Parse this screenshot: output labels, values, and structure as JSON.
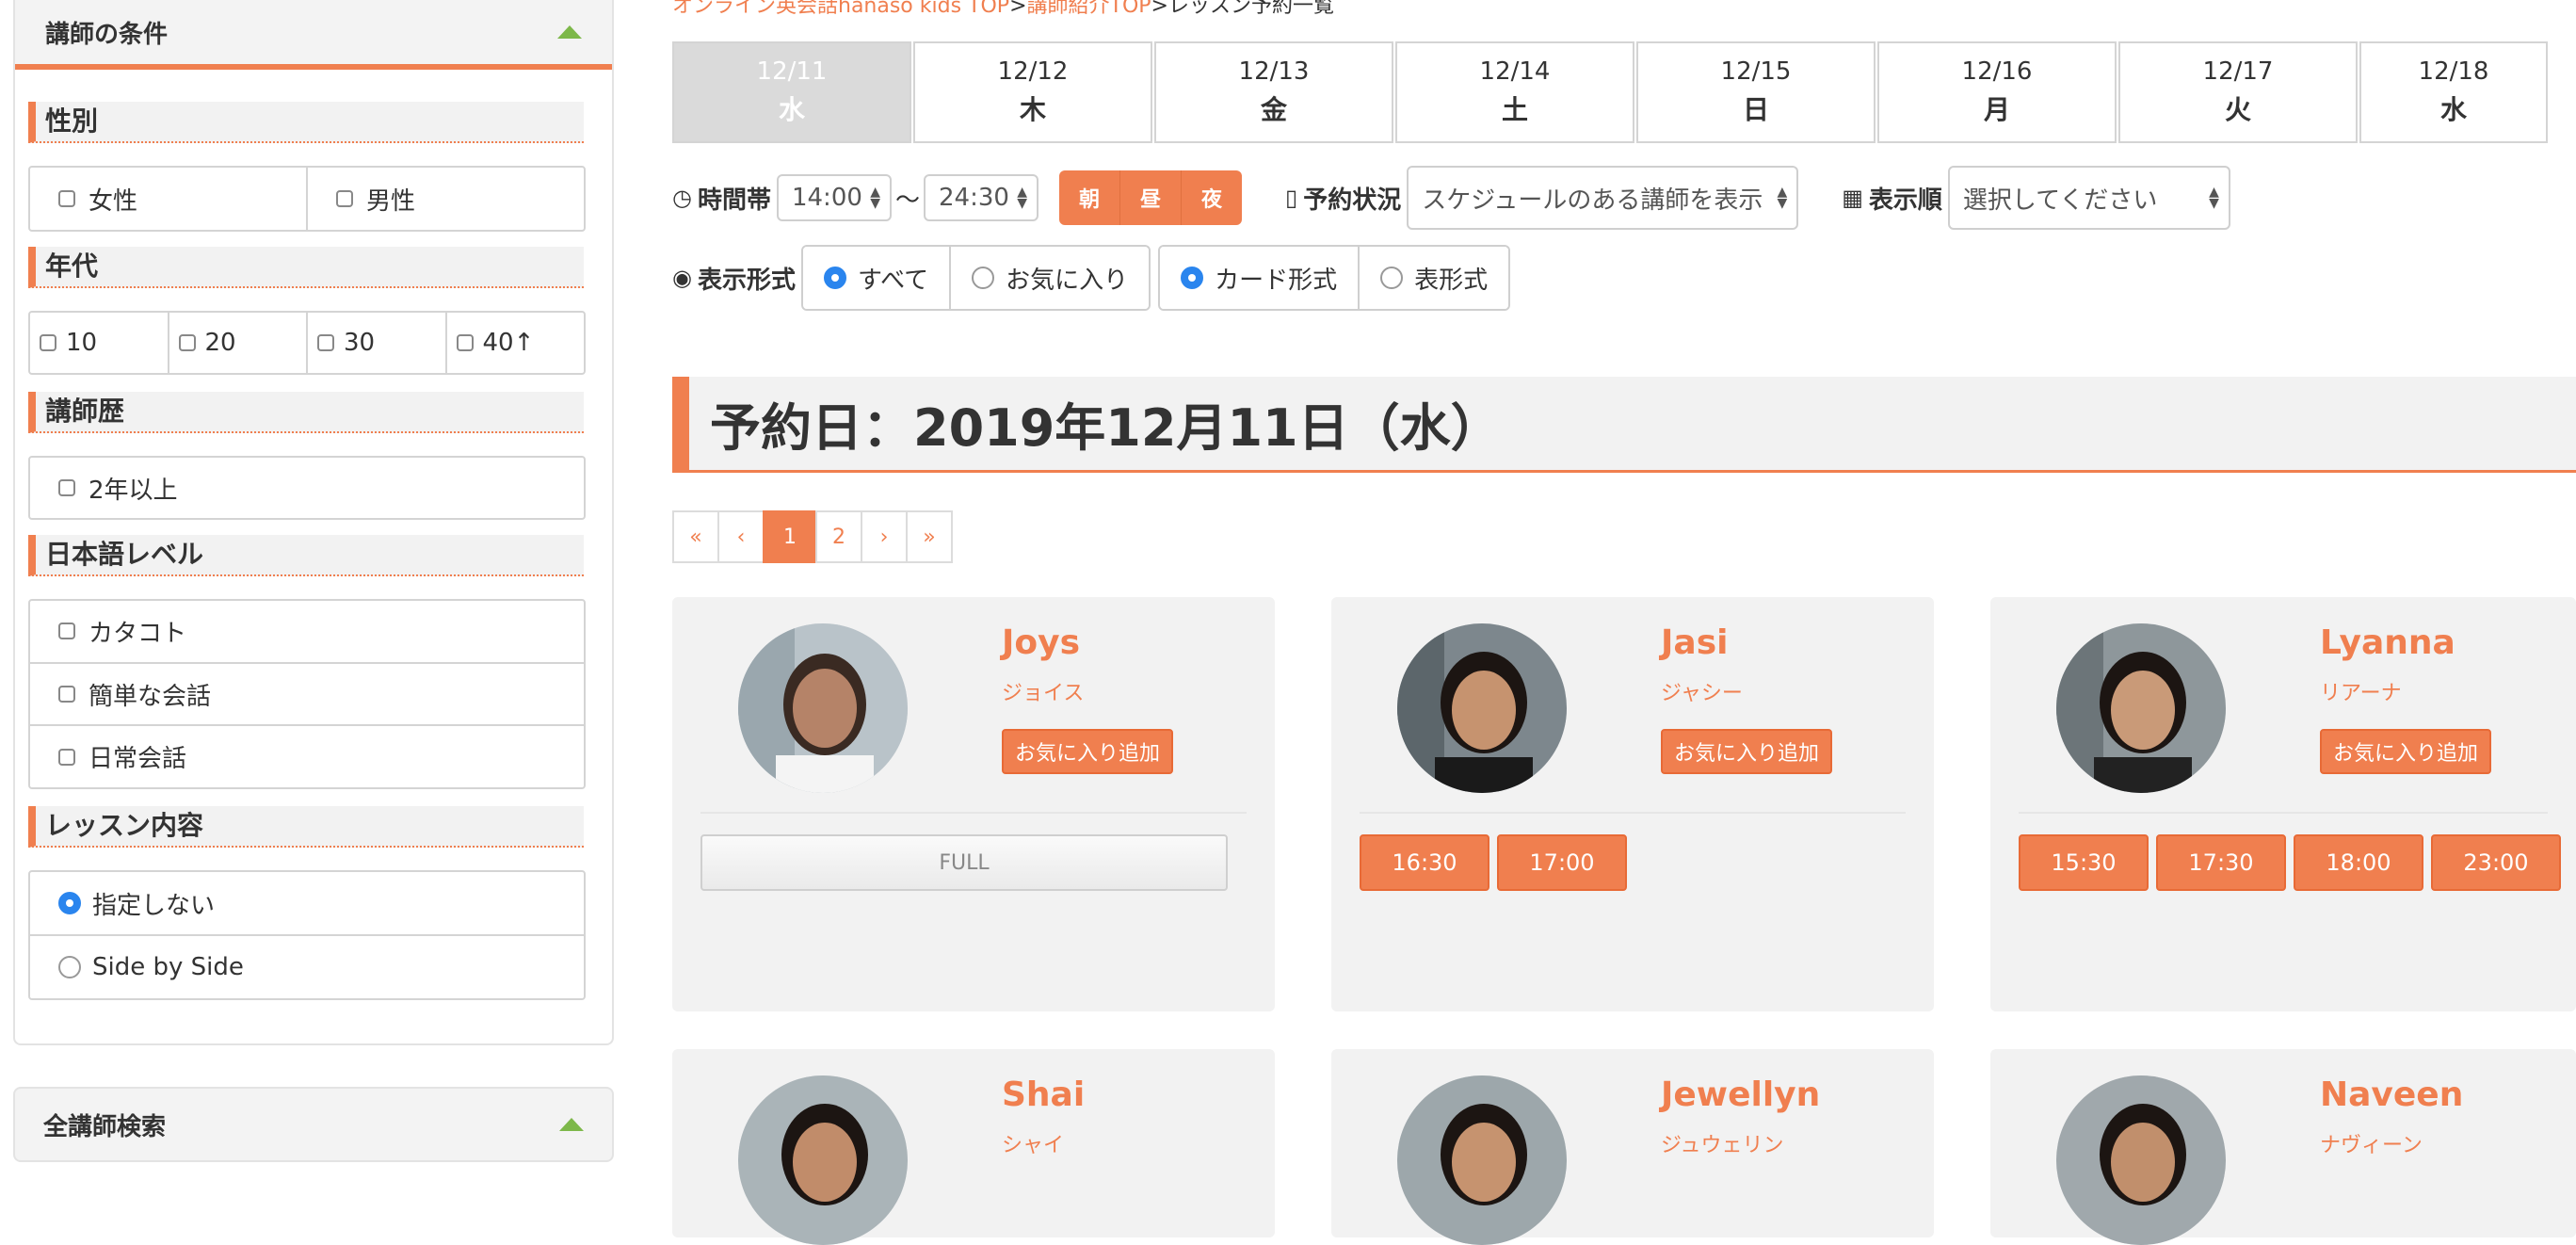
{
  "sidebar": {
    "header": "講師の条件",
    "gender": {
      "title": "性別",
      "options": [
        "女性",
        "男性"
      ]
    },
    "age": {
      "title": "年代",
      "options": [
        "10",
        "20",
        "30",
        "40↑"
      ]
    },
    "experience": {
      "title": "講師歴",
      "options": [
        "2年以上"
      ]
    },
    "japanese": {
      "title": "日本語レベル",
      "options": [
        "カタコト",
        "簡単な会話",
        "日常会話"
      ]
    },
    "lesson": {
      "title": "レッスン内容",
      "options": [
        "指定しない",
        "Side by Side"
      ],
      "selected": "指定しない"
    },
    "search_header": "全講師検索"
  },
  "breadcrumb": {
    "items": [
      "オンライン英会話hanaso kids TOP",
      "講師紹介TOP",
      "レッスン予約一覧"
    ],
    "separator": ">"
  },
  "dates": [
    {
      "date": "12/11",
      "weekday": "水",
      "active": true
    },
    {
      "date": "12/12",
      "weekday": "木"
    },
    {
      "date": "12/13",
      "weekday": "金"
    },
    {
      "date": "12/14",
      "weekday": "土"
    },
    {
      "date": "12/15",
      "weekday": "日"
    },
    {
      "date": "12/16",
      "weekday": "月"
    },
    {
      "date": "12/17",
      "weekday": "火"
    },
    {
      "date": "12/18",
      "weekday": "水"
    }
  ],
  "filters": {
    "time_label": "時間帯",
    "time_from": "14:00",
    "tilde": "〜",
    "time_to": "24:30",
    "periods": [
      "朝",
      "昼",
      "夜"
    ],
    "status_label": "予約状況",
    "status_value": "スケジュールのある講師を表示",
    "order_label": "表示順",
    "order_value": "選択してください",
    "display_label": "表示形式",
    "scope_options": [
      "すべて",
      "お気に入り"
    ],
    "scope_selected": "すべて",
    "format_options": [
      "カード形式",
      "表形式"
    ],
    "format_selected": "カード形式"
  },
  "day_title": "予約日：2019年12月11日（水）",
  "pager": [
    "«",
    "‹",
    "1",
    "2",
    "›",
    "»"
  ],
  "pager_current": "1",
  "teachers": [
    {
      "name": "Joys",
      "kana": "ジョイス",
      "fav": "お気に入り追加",
      "slots": [],
      "full": "FULL"
    },
    {
      "name": "Jasi",
      "kana": "ジャシー",
      "fav": "お気に入り追加",
      "slots": [
        "16:30",
        "17:00"
      ]
    },
    {
      "name": "Lyanna",
      "kana": "リアーナ",
      "fav": "お気に入り追加",
      "slots": [
        "15:30",
        "17:30",
        "18:00",
        "23:00"
      ]
    },
    {
      "name": "Shai",
      "kana": "シャイ"
    },
    {
      "name": "Jewellyn",
      "kana": "ジュウェリン"
    },
    {
      "name": "Naveen",
      "kana": "ナヴィーン"
    }
  ],
  "colors": {
    "accent": "#f07f4f",
    "radio": "#2a85ee",
    "collapse_icon": "#7db84a"
  }
}
